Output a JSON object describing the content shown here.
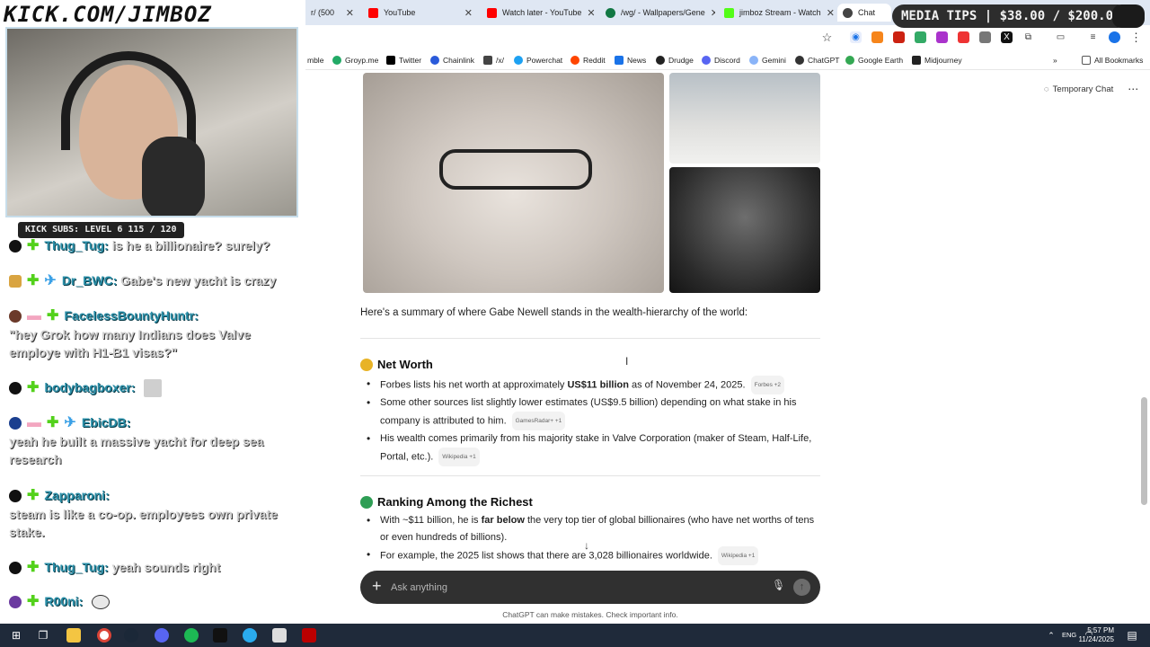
{
  "browser": {
    "tabs": [
      {
        "label": "r/ (500",
        "icon": "reddit-icon",
        "color": "#ff4500"
      },
      {
        "label": "YouTube",
        "icon": "youtube-icon",
        "color": "#ff0000"
      },
      {
        "label": "Watch later - YouTube",
        "icon": "youtube-icon",
        "color": "#ff0000"
      },
      {
        "label": "/wg/ - Wallpapers/Gene",
        "icon": "clover-icon",
        "color": "#117743"
      },
      {
        "label": "jimboz Stream - Watch",
        "icon": "kick-icon",
        "color": "#53fc18"
      },
      {
        "label": "Chat",
        "icon": "openai-icon",
        "color": "#444444"
      }
    ],
    "bookmarks": [
      {
        "label": "mble",
        "color": "#7a5"
      },
      {
        "label": "Groyp.me",
        "color": "#2a6"
      },
      {
        "label": "Twitter",
        "color": "#000"
      },
      {
        "label": "Chainlink",
        "color": "#2a5ada"
      },
      {
        "label": "/x/",
        "color": "#444"
      },
      {
        "label": "Powerchat",
        "color": "#1da1f2"
      },
      {
        "label": "Reddit",
        "color": "#ff4500"
      },
      {
        "label": "News",
        "color": "#1a73e8"
      },
      {
        "label": "Drudge",
        "color": "#222"
      },
      {
        "label": "Discord",
        "color": "#5865f2"
      },
      {
        "label": "Gemini",
        "color": "#8ab4f8"
      },
      {
        "label": "ChatGPT",
        "color": "#333"
      },
      {
        "label": "Google Earth",
        "color": "#34a853"
      },
      {
        "label": "Midjourney",
        "color": "#222"
      }
    ],
    "all_bookmarks": "All Bookmarks"
  },
  "stream": {
    "channel_url": "KICK.COM/JIMBOZ",
    "subs_bar": "KICK SUBS: LEVEL 6 115 / 120",
    "media_tips": "MEDIA TIPS | $38.00 / $200.00",
    "chat": [
      {
        "user": "Thug_Tug:",
        "msg": "is he a billionaire? surely?"
      },
      {
        "user": "Dr_BWC:",
        "msg": "Gabe's new yacht is crazy"
      },
      {
        "user": "FacelessBountyHuntr:",
        "msg": "\"hey Grok how many Indians does Valve employe with H1-B1 visas?\""
      },
      {
        "user": "bodybagboxer:",
        "msg": ""
      },
      {
        "user": "EbicDB:",
        "msg": "yeah he built a massive yacht for deep sea research"
      },
      {
        "user": "Zapparoni:",
        "msg": "steam is like a co-op. employees own private stake."
      },
      {
        "user": "Thug_Tug:",
        "msg": "yeah sounds right"
      },
      {
        "user": "R00ni:",
        "msg": ""
      }
    ]
  },
  "page": {
    "temporary_chat": "Temporary Chat",
    "summary": "Here's a summary of where Gabe Newell stands in the wealth-hierarchy of the world:",
    "section1": {
      "title": "Net Worth",
      "bullets": [
        {
          "pre": "Forbes lists his net worth at approximately ",
          "bold": "US$11 billion",
          "post": " as of November 24, 2025.",
          "cite": "Forbes +2"
        },
        {
          "pre": "Some other sources list slightly lower estimates (US$9.5 billion) depending on what stake in his company is attributed to him.",
          "bold": "",
          "post": "",
          "cite": "GamesRadar+ +1"
        },
        {
          "pre": "His wealth comes primarily from his majority stake in Valve Corporation (maker of Steam, Half-Life, Portal, etc.).",
          "bold": "",
          "post": "",
          "cite": "Wikipedia +1"
        }
      ]
    },
    "section2": {
      "title": "Ranking Among the Richest",
      "bullets": [
        {
          "pre": "With ~$11 billion, he is ",
          "bold": "far below",
          "post": " the very top tier of global billionaires (who have net worths of tens or even hundreds of billions).",
          "cite": ""
        },
        {
          "pre": "For example, the 2025 list shows that there are 3,028 billionaires worldwide.",
          "bold": "",
          "post": "",
          "cite": "Wikipedia +1"
        }
      ]
    },
    "composer_placeholder": "Ask anything",
    "disclaimer": "ChatGPT can make mistakes. Check important info."
  },
  "taskbar": {
    "lang": "ENG",
    "time": "5:57 PM",
    "date": "11/24/2025"
  }
}
